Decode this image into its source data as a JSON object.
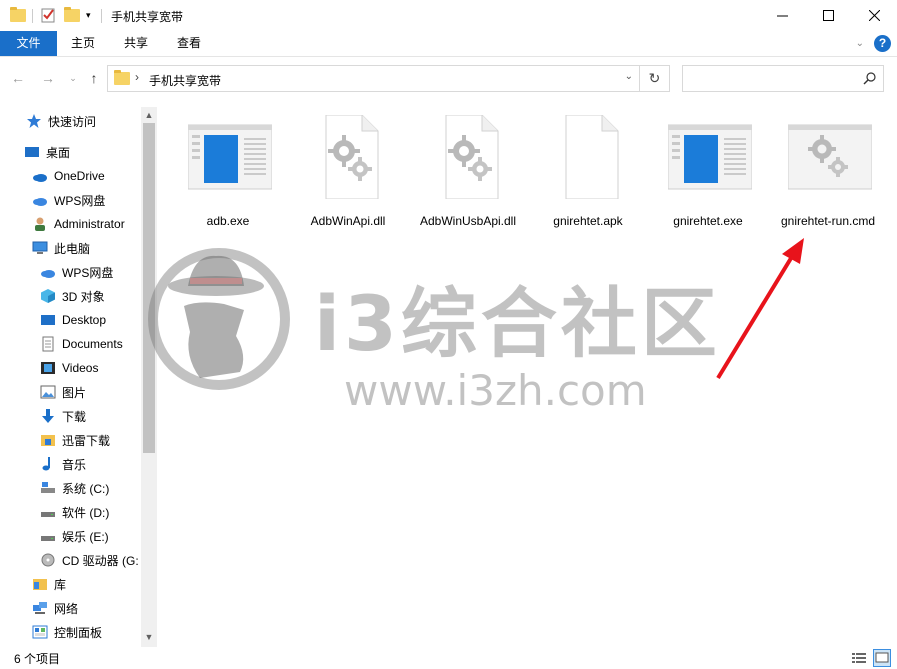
{
  "window": {
    "title": "手机共享宽带"
  },
  "ribbon": {
    "tabs": [
      {
        "label": "文件"
      },
      {
        "label": "主页"
      },
      {
        "label": "共享"
      },
      {
        "label": "查看"
      }
    ]
  },
  "address": {
    "path": "手机共享宽带"
  },
  "sidebar": {
    "items": [
      {
        "label": "快速访问",
        "icon": "star-icon"
      },
      {
        "label": "桌面",
        "icon": "desktop-icon"
      },
      {
        "label": "OneDrive",
        "icon": "cloud-icon"
      },
      {
        "label": "WPS网盘",
        "icon": "cloud-icon"
      },
      {
        "label": "Administrator",
        "icon": "user-icon"
      },
      {
        "label": "此电脑",
        "icon": "computer-icon"
      },
      {
        "label": "WPS网盘",
        "icon": "cloud-icon"
      },
      {
        "label": "3D 对象",
        "icon": "cube-icon"
      },
      {
        "label": "Desktop",
        "icon": "desktop-icon"
      },
      {
        "label": "Documents",
        "icon": "document-icon"
      },
      {
        "label": "Videos",
        "icon": "video-icon"
      },
      {
        "label": "图片",
        "icon": "picture-icon"
      },
      {
        "label": "下载",
        "icon": "download-icon"
      },
      {
        "label": "迅雷下载",
        "icon": "folder-icon"
      },
      {
        "label": "音乐",
        "icon": "music-icon"
      },
      {
        "label": "系统 (C:)",
        "icon": "drive-icon"
      },
      {
        "label": "软件 (D:)",
        "icon": "drive-icon"
      },
      {
        "label": "娱乐 (E:)",
        "icon": "drive-icon"
      },
      {
        "label": "CD 驱动器 (G:",
        "icon": "cd-drive-icon"
      },
      {
        "label": "库",
        "icon": "library-icon"
      },
      {
        "label": "网络",
        "icon": "network-icon"
      },
      {
        "label": "控制面板",
        "icon": "control-panel-icon"
      }
    ]
  },
  "files": [
    {
      "name": "adb.exe",
      "type": "exe"
    },
    {
      "name": "AdbWinApi.dll",
      "type": "dll"
    },
    {
      "name": "AdbWinUsbApi.dll",
      "type": "dll"
    },
    {
      "name": "gnirehtet.apk",
      "type": "blank"
    },
    {
      "name": "gnirehtet.exe",
      "type": "exe"
    },
    {
      "name": "gnirehtet-run.cmd",
      "type": "cmd"
    }
  ],
  "status": {
    "count": "6 个项目"
  },
  "watermark": {
    "text": "i3综合社区",
    "url": "www.i3zh.com"
  },
  "colors": {
    "accent": "#1a6fc9",
    "arrow": "#e8131b"
  }
}
